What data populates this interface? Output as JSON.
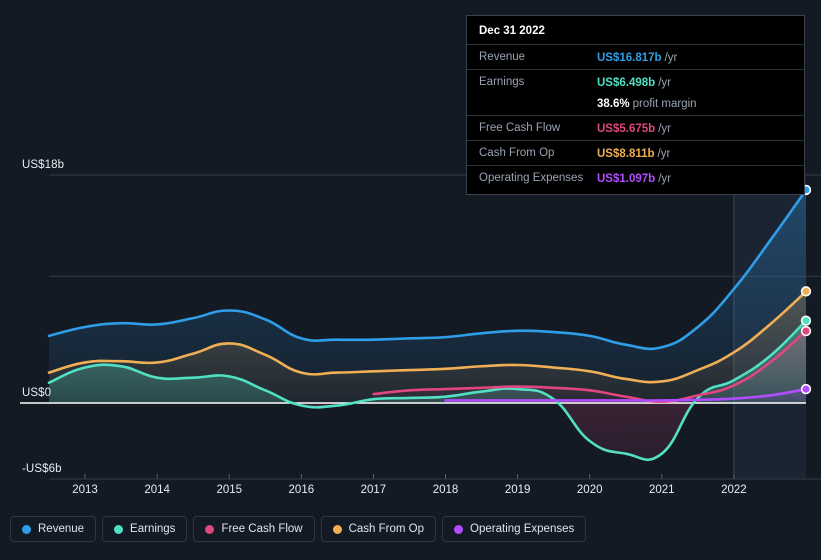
{
  "colors": {
    "background": "#141a24",
    "revenue": "#2f9ee8",
    "earnings": "#52e0c4",
    "free_cash_flow": "#e0477f",
    "cash_from_op": "#f0ae55",
    "operating_expenses": "#b24dff",
    "zero_line": "#ffffff",
    "grid": "#343b48"
  },
  "tooltip": {
    "title": "Dec 31 2022",
    "rows": [
      {
        "label": "Revenue",
        "value": "US$16.817b",
        "unit": "/yr",
        "color": "#2f9ee8"
      },
      {
        "label": "Earnings",
        "value": "US$6.498b",
        "unit": "/yr",
        "color": "#52e0c4"
      },
      {
        "label": "",
        "value": "38.6%",
        "unit": "profit margin",
        "color": "#ffffff",
        "sub": true
      },
      {
        "label": "Free Cash Flow",
        "value": "US$5.675b",
        "unit": "/yr",
        "color": "#e0477f"
      },
      {
        "label": "Cash From Op",
        "value": "US$8.811b",
        "unit": "/yr",
        "color": "#f0ae55"
      },
      {
        "label": "Operating Expenses",
        "value": "US$1.097b",
        "unit": "/yr",
        "color": "#b24dff"
      }
    ]
  },
  "legend": [
    {
      "label": "Revenue",
      "color": "#2f9ee8"
    },
    {
      "label": "Earnings",
      "color": "#52e0c4"
    },
    {
      "label": "Free Cash Flow",
      "color": "#e0477f"
    },
    {
      "label": "Cash From Op",
      "color": "#f0ae55"
    },
    {
      "label": "Operating Expenses",
      "color": "#b24dff"
    }
  ],
  "chart_data": {
    "type": "area",
    "title": "",
    "xlabel": "",
    "ylabel": "",
    "x_tick_labels": [
      "2013",
      "2014",
      "2015",
      "2016",
      "2017",
      "2018",
      "2019",
      "2020",
      "2021",
      "2022"
    ],
    "x_tick_values": [
      2013,
      2014,
      2015,
      2016,
      2017,
      2018,
      2019,
      2020,
      2021,
      2022
    ],
    "y_tick_labels": [
      "US$18b",
      "US$0",
      "-US$6b"
    ],
    "y_tick_values": [
      18,
      0,
      -6
    ],
    "ylim": [
      -6.8,
      18.3
    ],
    "xlim": [
      2012.5,
      2023.0
    ],
    "grid": true,
    "gridlines_y": [
      18,
      10
    ],
    "zero_line": 0,
    "units": "US$ billions per year",
    "forecast_boundary_x": 2022,
    "legend_position": "bottom-left",
    "series": [
      {
        "name": "Revenue",
        "color": "#2f9ee8",
        "x": [
          2012.5,
          2013,
          2013.5,
          2014,
          2014.5,
          2015,
          2015.5,
          2016,
          2016.5,
          2017,
          2017.5,
          2018,
          2018.5,
          2019,
          2019.5,
          2020,
          2020.5,
          2021,
          2021.5,
          2022,
          2022.5,
          2023
        ],
        "values": [
          5.3,
          6.0,
          6.3,
          6.2,
          6.7,
          7.3,
          6.6,
          5.1,
          5.0,
          5.0,
          5.1,
          5.2,
          5.5,
          5.7,
          5.6,
          5.3,
          4.6,
          4.4,
          6.0,
          9.0,
          12.8,
          16.8
        ]
      },
      {
        "name": "Earnings",
        "color": "#52e0c4",
        "x": [
          2012.5,
          2013,
          2013.5,
          2014,
          2014.5,
          2015,
          2015.5,
          2016,
          2016.5,
          2017,
          2017.5,
          2018,
          2018.5,
          2019,
          2019.5,
          2020,
          2020.5,
          2021,
          2021.5,
          2022,
          2022.5,
          2023
        ],
        "values": [
          1.6,
          2.8,
          2.9,
          2.0,
          2.0,
          2.1,
          1.0,
          -0.2,
          -0.2,
          0.3,
          0.4,
          0.5,
          0.9,
          1.1,
          0.3,
          -3.0,
          -4.0,
          -4.0,
          0.4,
          1.8,
          3.7,
          6.5
        ]
      },
      {
        "name": "Free Cash Flow",
        "color": "#e0477f",
        "x": [
          2017,
          2017.5,
          2018,
          2018.5,
          2019,
          2019.5,
          2020,
          2020.5,
          2021,
          2021.5,
          2022,
          2022.5,
          2023
        ],
        "values": [
          0.7,
          1.0,
          1.1,
          1.2,
          1.3,
          1.2,
          1.0,
          0.5,
          0.1,
          0.6,
          1.4,
          3.2,
          5.7
        ]
      },
      {
        "name": "Cash From Op",
        "color": "#f0ae55",
        "x": [
          2012.5,
          2013,
          2013.5,
          2014,
          2014.5,
          2015,
          2015.5,
          2016,
          2016.5,
          2017,
          2017.5,
          2018,
          2018.5,
          2019,
          2019.5,
          2020,
          2020.5,
          2021,
          2021.5,
          2022,
          2022.5,
          2023
        ],
        "values": [
          2.4,
          3.2,
          3.3,
          3.2,
          3.9,
          4.7,
          3.8,
          2.4,
          2.4,
          2.5,
          2.6,
          2.7,
          2.9,
          3.0,
          2.8,
          2.5,
          1.9,
          1.7,
          2.6,
          4.0,
          6.2,
          8.8
        ]
      },
      {
        "name": "Operating Expenses",
        "color": "#b24dff",
        "x": [
          2018,
          2018.5,
          2019,
          2019.5,
          2020,
          2020.5,
          2021,
          2021.5,
          2022,
          2022.5,
          2023
        ],
        "values": [
          0.2,
          0.2,
          0.2,
          0.2,
          0.2,
          0.2,
          0.2,
          0.25,
          0.35,
          0.6,
          1.1
        ]
      }
    ],
    "endpoint_markers": [
      {
        "name": "Revenue",
        "x": 2023,
        "value": 16.817,
        "color": "#2f9ee8"
      },
      {
        "name": "Cash From Op",
        "x": 2023,
        "value": 8.811,
        "color": "#f0ae55"
      },
      {
        "name": "Earnings",
        "x": 2023,
        "value": 6.498,
        "color": "#52e0c4"
      },
      {
        "name": "Free Cash Flow",
        "x": 2023,
        "value": 5.675,
        "color": "#e0477f"
      },
      {
        "name": "Operating Expenses",
        "x": 2023,
        "value": 1.097,
        "color": "#b24dff"
      }
    ]
  }
}
